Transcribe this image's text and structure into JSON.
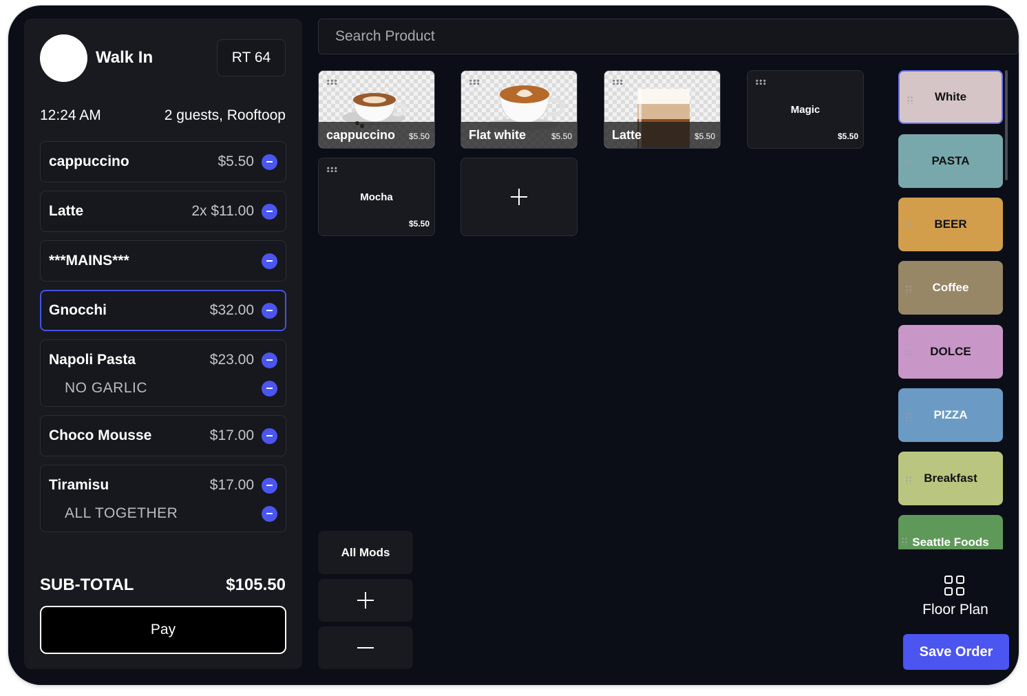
{
  "order": {
    "customer_name": "Walk In",
    "table": "RT 64",
    "time": "12:24 AM",
    "guests": "2 guests, Rooftoop",
    "items": [
      {
        "name": "cappuccino",
        "price": "$5.50"
      },
      {
        "name": "Latte",
        "price": "2x $11.00"
      },
      {
        "name": "***MAINS***",
        "price": ""
      },
      {
        "name": "Gnocchi",
        "price": "$32.00"
      },
      {
        "name": "Napoli Pasta",
        "price": "$23.00",
        "modifier": "NO GARLIC"
      },
      {
        "name": "Choco Mousse",
        "price": "$17.00"
      },
      {
        "name": "Tiramisu",
        "price": "$17.00",
        "modifier": "ALL TOGETHER"
      }
    ],
    "subtotal_label": "SUB-TOTAL",
    "subtotal_value": "$105.50",
    "pay_label": "Pay"
  },
  "search": {
    "placeholder": "Search Product"
  },
  "products": [
    {
      "name": "cappuccino",
      "price": "$5.50",
      "image": "cappuccino-cup"
    },
    {
      "name": "Flat white",
      "price": "$5.50",
      "image": "flat-white-cup"
    },
    {
      "name": "Latte",
      "price": "$5.50",
      "image": "latte-glass"
    },
    {
      "name": "Magic",
      "price": "$5.50"
    },
    {
      "name": "Mocha",
      "price": "$5.50"
    }
  ],
  "mods": {
    "all_label": "All Mods"
  },
  "categories": [
    {
      "label": "White",
      "color": "#d6c5c6"
    },
    {
      "label": "PASTA",
      "color": "#78a8ab"
    },
    {
      "label": "BEER",
      "color": "#d29e4c"
    },
    {
      "label": "Coffee",
      "color": "#978766"
    },
    {
      "label": "DOLCE",
      "color": "#c996c8"
    },
    {
      "label": "PIZZA",
      "color": "#6b9ac4"
    },
    {
      "label": "Breakfast",
      "color": "#bac67f"
    },
    {
      "label": "Seattle Foods",
      "color": "#5f9959"
    }
  ],
  "floor_plan_label": "Floor Plan",
  "save_order_label": "Save Order",
  "colors": {
    "accent": "#4b55f0",
    "background": "#0b0e17",
    "panel": "#181a1f"
  }
}
